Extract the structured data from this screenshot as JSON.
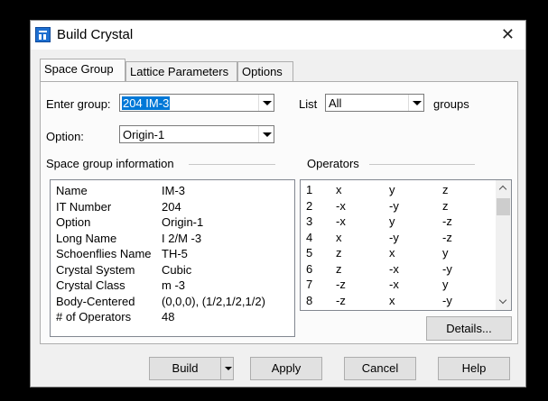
{
  "window": {
    "title": "Build Crystal"
  },
  "tabs": [
    {
      "label": "Space Group",
      "active": true
    },
    {
      "label": "Lattice Parameters",
      "active": false
    },
    {
      "label": "Options",
      "active": false
    }
  ],
  "space_group_tab": {
    "enter_group_label": "Enter group:",
    "enter_group_value": "204  IM-3",
    "list_label": "List",
    "list_value": "All",
    "groups_label": "groups",
    "option_label": "Option:",
    "option_value": "Origin-1",
    "info_header": "Space group information",
    "operators_header": "Operators",
    "info": [
      {
        "key": "Name",
        "value": "IM-3"
      },
      {
        "key": "IT Number",
        "value": "204"
      },
      {
        "key": "Option",
        "value": "Origin-1"
      },
      {
        "key": "Long Name",
        "value": "I 2/M -3"
      },
      {
        "key": "Schoenflies Name",
        "value": "TH-5"
      },
      {
        "key": "Crystal System",
        "value": "Cubic"
      },
      {
        "key": "Crystal Class",
        "value": "m -3"
      },
      {
        "key": "Body-Centered",
        "value": "(0,0,0), (1/2,1/2,1/2)"
      },
      {
        "key": "# of Operators",
        "value": "48"
      }
    ],
    "operators": [
      {
        "n": "1",
        "x": "x",
        "y": "y",
        "z": "z"
      },
      {
        "n": "2",
        "x": "-x",
        "y": "-y",
        "z": "z"
      },
      {
        "n": "3",
        "x": "-x",
        "y": "y",
        "z": "-z"
      },
      {
        "n": "4",
        "x": "x",
        "y": "-y",
        "z": "-z"
      },
      {
        "n": "5",
        "x": "z",
        "y": "x",
        "z": "y"
      },
      {
        "n": "6",
        "x": "z",
        "y": "-x",
        "z": "-y"
      },
      {
        "n": "7",
        "x": "-z",
        "y": "-x",
        "z": "y"
      },
      {
        "n": "8",
        "x": "-z",
        "y": "x",
        "z": "-y"
      }
    ],
    "details_label": "Details..."
  },
  "footer": {
    "build_label": "Build",
    "apply_label": "Apply",
    "cancel_label": "Cancel",
    "help_label": "Help"
  },
  "colors": {
    "selection": "#0078d7",
    "window_bg": "#f0f0f0",
    "panel_bg": "#fbfbfb"
  }
}
